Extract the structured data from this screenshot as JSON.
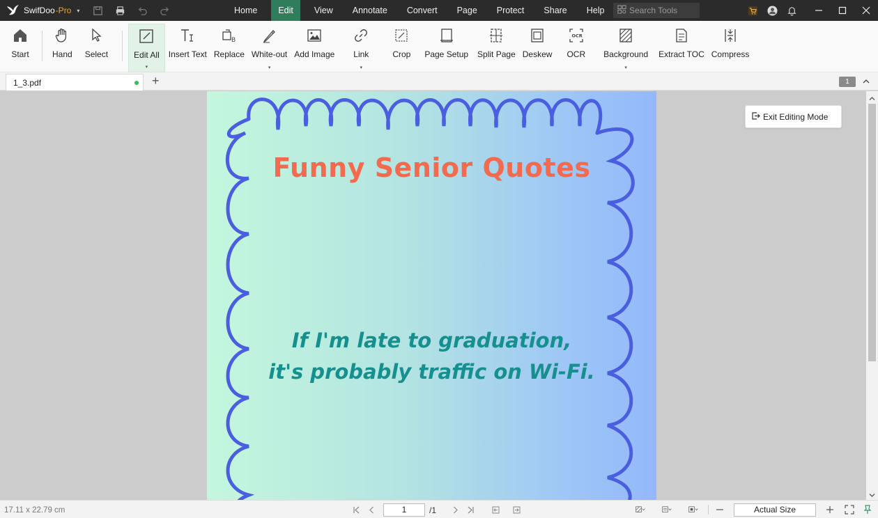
{
  "app": {
    "name": "SwifDoo",
    "edition": "-Pro",
    "caret": "▾"
  },
  "menu": [
    {
      "label": "Home",
      "active": false
    },
    {
      "label": "Edit",
      "active": true
    },
    {
      "label": "View",
      "active": false
    },
    {
      "label": "Annotate",
      "active": false
    },
    {
      "label": "Convert",
      "active": false
    },
    {
      "label": "Page",
      "active": false
    },
    {
      "label": "Protect",
      "active": false
    },
    {
      "label": "Share",
      "active": false
    },
    {
      "label": "Help",
      "active": false
    }
  ],
  "search": {
    "placeholder": "Search Tools"
  },
  "toolbar": {
    "start": "Start",
    "hand": "Hand",
    "select": "Select",
    "edit_all": "Edit All",
    "insert_text": "Insert Text",
    "replace": "Replace",
    "white_out": "White-out",
    "add_image": "Add Image",
    "link": "Link",
    "crop": "Crop",
    "page_setup": "Page Setup",
    "split_page": "Split Page",
    "deskew": "Deskew",
    "ocr": "OCR",
    "background": "Background",
    "extract_toc": "Extract TOC",
    "compress": "Compress",
    "drop_glyph": "▾"
  },
  "tabs": {
    "doc_name": "1_3.pdf",
    "add": "+",
    "page_count_badge": "1"
  },
  "document": {
    "title": "Funny Senior Quotes",
    "line1": "If I'm late to graduation,",
    "line2": "it's probably traffic on Wi-Fi."
  },
  "exit_editing": "Exit Editing Mode",
  "status": {
    "dimensions": "17.11 x 22.79 cm",
    "current_page": "1",
    "total_pages": "/1",
    "zoom": "Actual Size"
  },
  "colors": {
    "active_menu": "#2f7d5a",
    "title_text": "#f26b4f",
    "quote_text": "#15908f",
    "frame": "#4a5fe0"
  }
}
